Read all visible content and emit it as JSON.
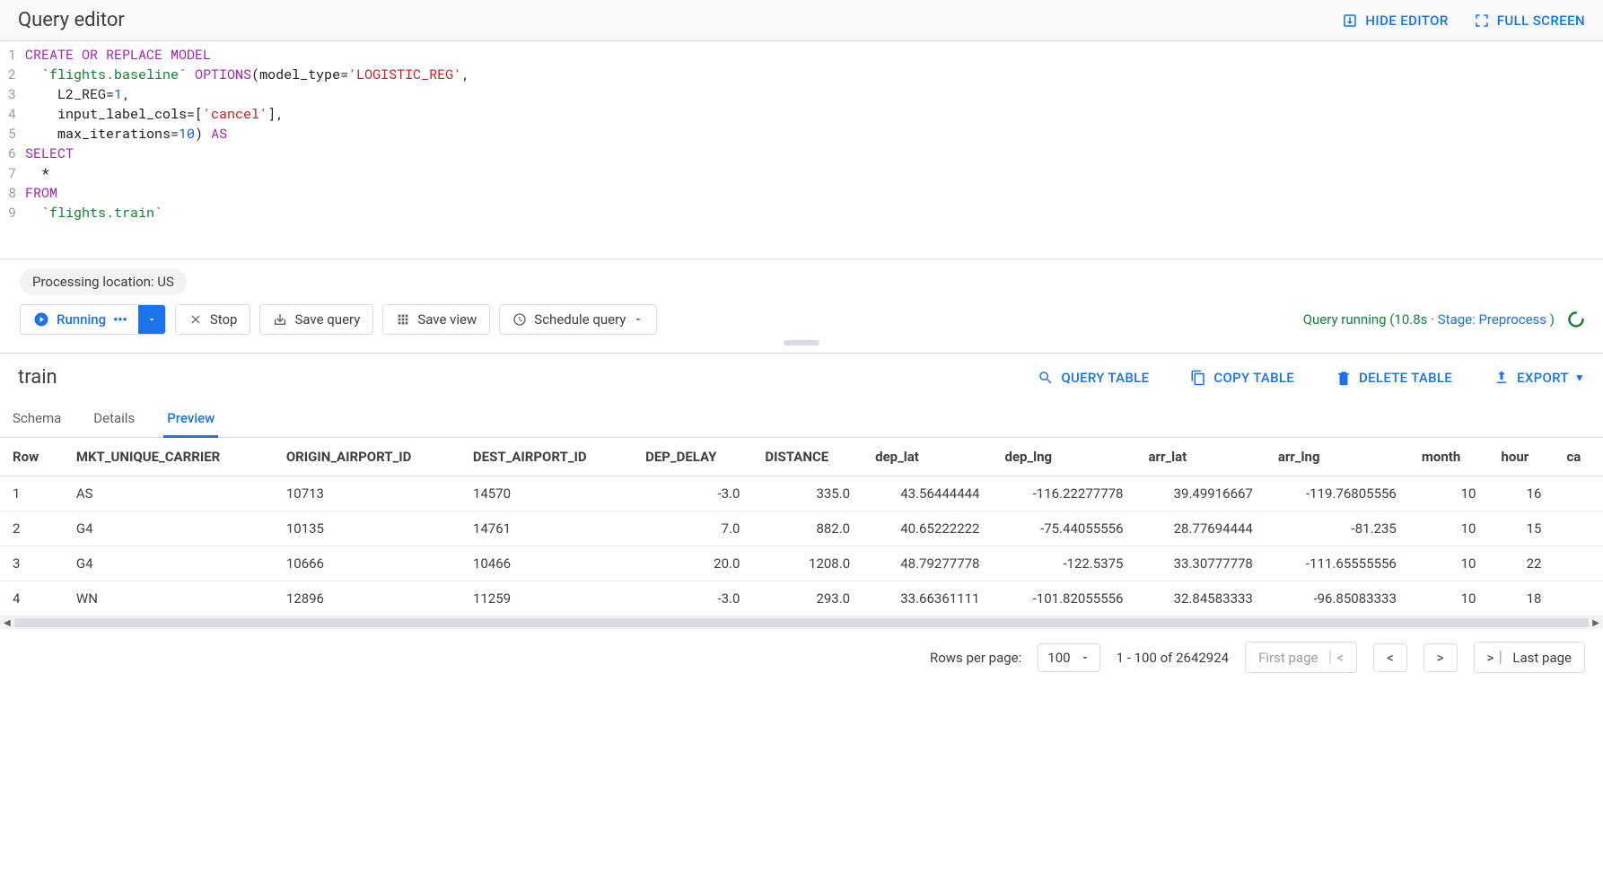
{
  "header": {
    "title": "Query editor",
    "hide_editor": "HIDE EDITOR",
    "full_screen": "FULL SCREEN"
  },
  "code": {
    "lines": [
      "1",
      "2",
      "3",
      "4",
      "5",
      "6",
      "7",
      "8",
      "9"
    ],
    "l1_a": "CREATE OR REPLACE MODEL",
    "l2_a": "  ",
    "l2_ref": "`flights.baseline`",
    "l2_opt": " OPTIONS",
    "l2_paren": "(model_type=",
    "l2_str": "'LOGISTIC_REG'",
    "l2_end": ",",
    "l3": "    L2_REG=",
    "l3_num": "1",
    "l3_end": ",",
    "l4": "    input_label_cols=[",
    "l4_str": "'cancel'",
    "l4_end": "],",
    "l5": "    max_iterations=",
    "l5_num": "10",
    "l5_close": ") ",
    "l5_as": "AS",
    "l6": "SELECT",
    "l7": "  *",
    "l8": "FROM",
    "l9": "  ",
    "l9_ref": "`flights.train`"
  },
  "controls": {
    "processing": "Processing location: US",
    "running": "Running",
    "dots": "• • •",
    "stop": "Stop",
    "save_query": "Save query",
    "save_view": "Save view",
    "schedule": "Schedule query",
    "status_prefix": "Query running (10.8s · ",
    "status_stage": "Stage: Preprocess ",
    "status_suffix": ")"
  },
  "table": {
    "title": "train",
    "query_table": "QUERY TABLE",
    "copy_table": "COPY TABLE",
    "delete_table": "DELETE TABLE",
    "export": "EXPORT"
  },
  "tabs": {
    "schema": "Schema",
    "details": "Details",
    "preview": "Preview"
  },
  "columns": [
    "Row",
    "MKT_UNIQUE_CARRIER",
    "ORIGIN_AIRPORT_ID",
    "DEST_AIRPORT_ID",
    "DEP_DELAY",
    "DISTANCE",
    "dep_lat",
    "dep_lng",
    "arr_lat",
    "arr_lng",
    "month",
    "hour",
    "ca"
  ],
  "rows": [
    {
      "row": "1",
      "carrier": "AS",
      "origin": "10713",
      "dest": "14570",
      "dep_delay": "-3.0",
      "distance": "335.0",
      "dep_lat": "43.56444444",
      "dep_lng": "-116.22277778",
      "arr_lat": "39.49916667",
      "arr_lng": "-119.76805556",
      "month": "10",
      "hour": "16"
    },
    {
      "row": "2",
      "carrier": "G4",
      "origin": "10135",
      "dest": "14761",
      "dep_delay": "7.0",
      "distance": "882.0",
      "dep_lat": "40.65222222",
      "dep_lng": "-75.44055556",
      "arr_lat": "28.77694444",
      "arr_lng": "-81.235",
      "month": "10",
      "hour": "15"
    },
    {
      "row": "3",
      "carrier": "G4",
      "origin": "10666",
      "dest": "10466",
      "dep_delay": "20.0",
      "distance": "1208.0",
      "dep_lat": "48.79277778",
      "dep_lng": "-122.5375",
      "arr_lat": "33.30777778",
      "arr_lng": "-111.65555556",
      "month": "10",
      "hour": "22"
    },
    {
      "row": "4",
      "carrier": "WN",
      "origin": "12896",
      "dest": "11259",
      "dep_delay": "-3.0",
      "distance": "293.0",
      "dep_lat": "33.66361111",
      "dep_lng": "-101.82055556",
      "arr_lat": "32.84583333",
      "arr_lng": "-96.85083333",
      "month": "10",
      "hour": "18"
    }
  ],
  "pagination": {
    "rows_per_page": "Rows per page:",
    "page_size": "100",
    "range": "1 - 100 of 2642924",
    "first": "First page",
    "last": "Last page"
  }
}
